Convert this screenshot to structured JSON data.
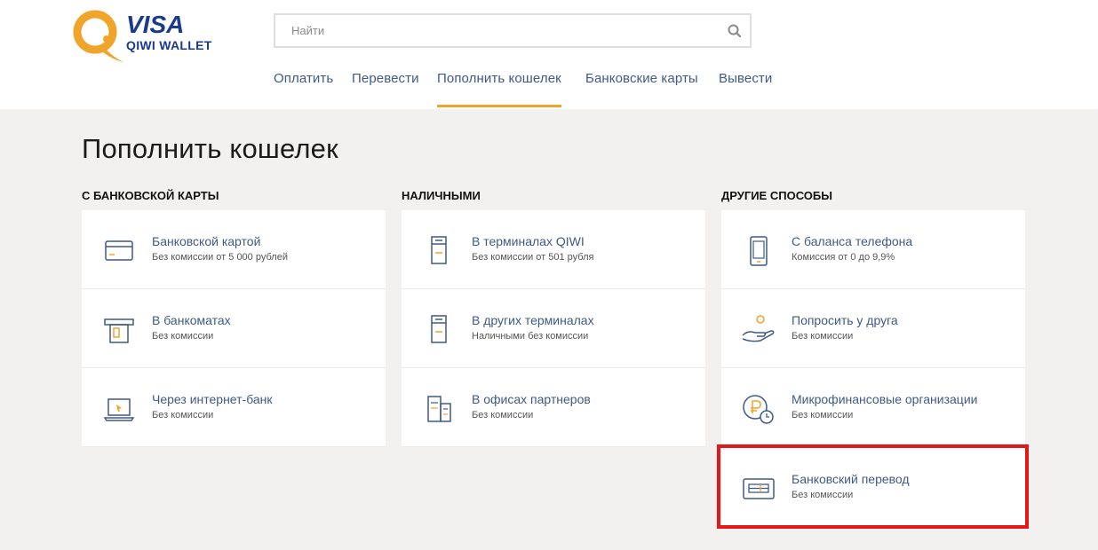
{
  "logo": {
    "visa": "VISA",
    "wallet": "QIWI WALLET",
    "colors": {
      "orange": "#f0a42a",
      "blue": "#1a3a8c"
    }
  },
  "search": {
    "placeholder": "Найти",
    "value": ""
  },
  "nav": {
    "items": [
      {
        "label": "Оплатить"
      },
      {
        "label": "Перевести"
      },
      {
        "label": "Пополнить кошелек",
        "active": true
      },
      {
        "label": "Банковские карты"
      },
      {
        "label": "Вывести"
      }
    ]
  },
  "page_title": "Пополнить кошелек",
  "columns": [
    {
      "heading": "С банковской карты",
      "items": [
        {
          "title": "Банковской картой",
          "subtitle": "Без комиссии от 5 000 рублей",
          "icon": "bank-card-icon"
        },
        {
          "title": "В банкоматах",
          "subtitle": "Без комиссии",
          "icon": "atm-icon"
        },
        {
          "title": "Через интернет-банк",
          "subtitle": "Без комиссии",
          "icon": "laptop-icon"
        }
      ]
    },
    {
      "heading": "Наличными",
      "items": [
        {
          "title": "В терминалах QIWI",
          "subtitle": "Без комиссии от 501 рубля",
          "icon": "terminal-icon"
        },
        {
          "title": "В других терминалах",
          "subtitle": "Наличными без комиссии",
          "icon": "terminal-icon"
        },
        {
          "title": "В офисах партнеров",
          "subtitle": "Без комиссии",
          "icon": "office-building-icon"
        }
      ]
    },
    {
      "heading": "Другие способы",
      "items": [
        {
          "title": "С баланса телефона",
          "subtitle": "Комиссия от 0 до 9,9%",
          "icon": "phone-icon"
        },
        {
          "title": "Попросить у друга",
          "subtitle": "Без комиссии",
          "icon": "hand-coin-icon"
        },
        {
          "title": "Микрофинансовые организации",
          "subtitle": "Без комиссии",
          "icon": "ruble-clock-icon"
        },
        {
          "title": "Банковский перевод",
          "subtitle": "Без комиссии",
          "icon": "bank-transfer-icon",
          "highlighted": true
        }
      ]
    }
  ],
  "colors": {
    "link": "#3e5a86",
    "accent": "#f0a42a",
    "highlight": "#e31818",
    "background": "#f2f1ef"
  }
}
